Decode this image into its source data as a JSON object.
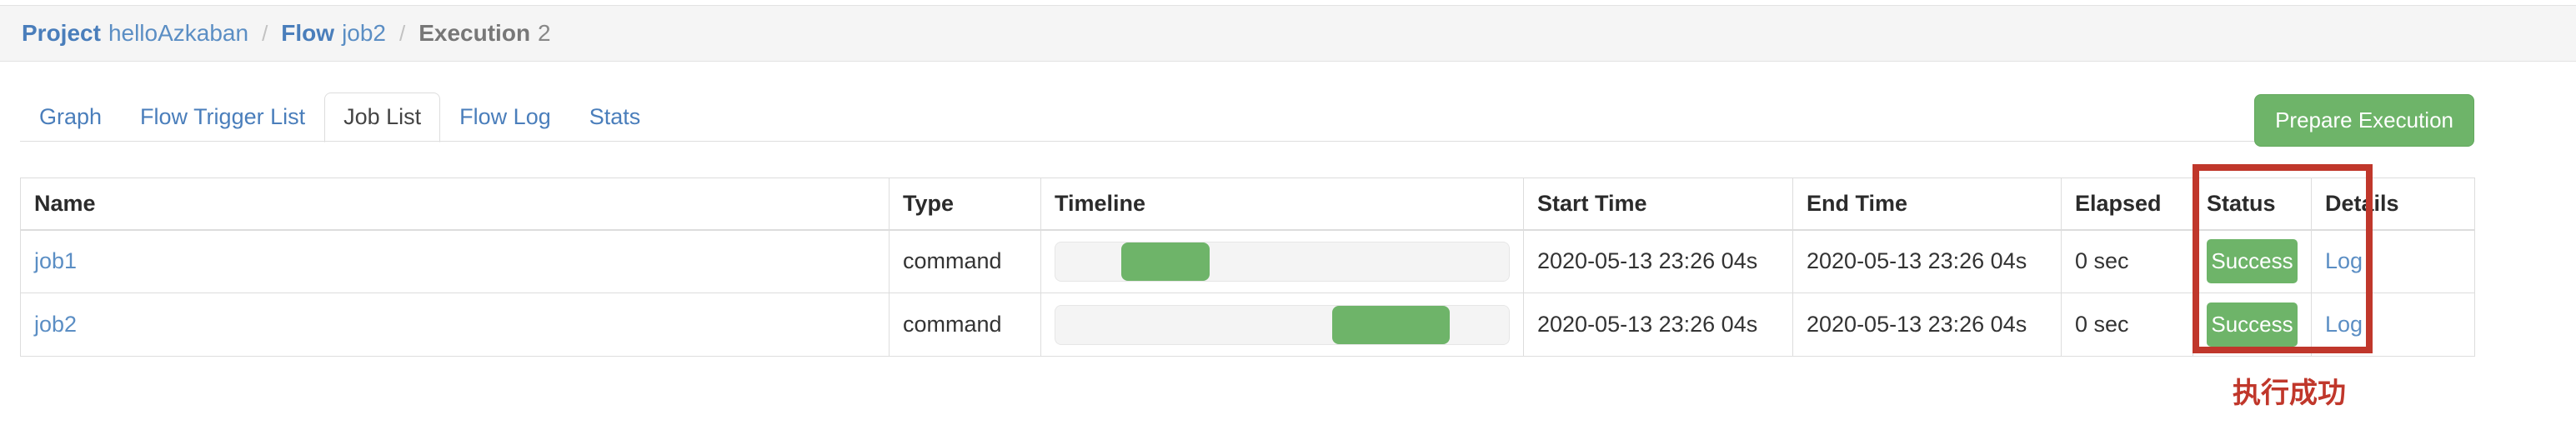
{
  "breadcrumb": {
    "separator": "/",
    "items": [
      {
        "label": "Project",
        "value": "helloAzkaban",
        "active": false
      },
      {
        "label": "Flow",
        "value": "job2",
        "active": false
      },
      {
        "label": "Execution",
        "value": "2",
        "active": true
      }
    ]
  },
  "tabs": {
    "items": [
      {
        "label": "Graph",
        "active": false
      },
      {
        "label": "Flow Trigger List",
        "active": false
      },
      {
        "label": "Job List",
        "active": true
      },
      {
        "label": "Flow Log",
        "active": false
      },
      {
        "label": "Stats",
        "active": false
      }
    ],
    "prepare_button": "Prepare Execution"
  },
  "table": {
    "columns": [
      "Name",
      "Type",
      "Timeline",
      "Start Time",
      "End Time",
      "Elapsed",
      "Status",
      "Details"
    ],
    "rows": [
      {
        "name": "job1",
        "type": "command",
        "timeline": {
          "start_pct": 14.5,
          "width_pct": 19.5
        },
        "start_time": "2020-05-13 23:26 04s",
        "end_time": "2020-05-13 23:26 04s",
        "elapsed": "0 sec",
        "status": "Success",
        "details": "Log"
      },
      {
        "name": "job2",
        "type": "command",
        "timeline": {
          "start_pct": 61.0,
          "width_pct": 26.0
        },
        "start_time": "2020-05-13 23:26 04s",
        "end_time": "2020-05-13 23:26 04s",
        "elapsed": "0 sec",
        "status": "Success",
        "details": "Log"
      }
    ]
  },
  "annotation": {
    "text": "执行成功",
    "color": "#c0372b"
  },
  "colors": {
    "success_green": "#6eb469",
    "link_blue": "#5b8ec4",
    "crumb_blue": "#4a7ebb",
    "annotation_red": "#c0372b",
    "border_gray": "#dddddd",
    "bar_background": "#f4f4f4",
    "breadcrumb_background": "#f5f5f5"
  }
}
